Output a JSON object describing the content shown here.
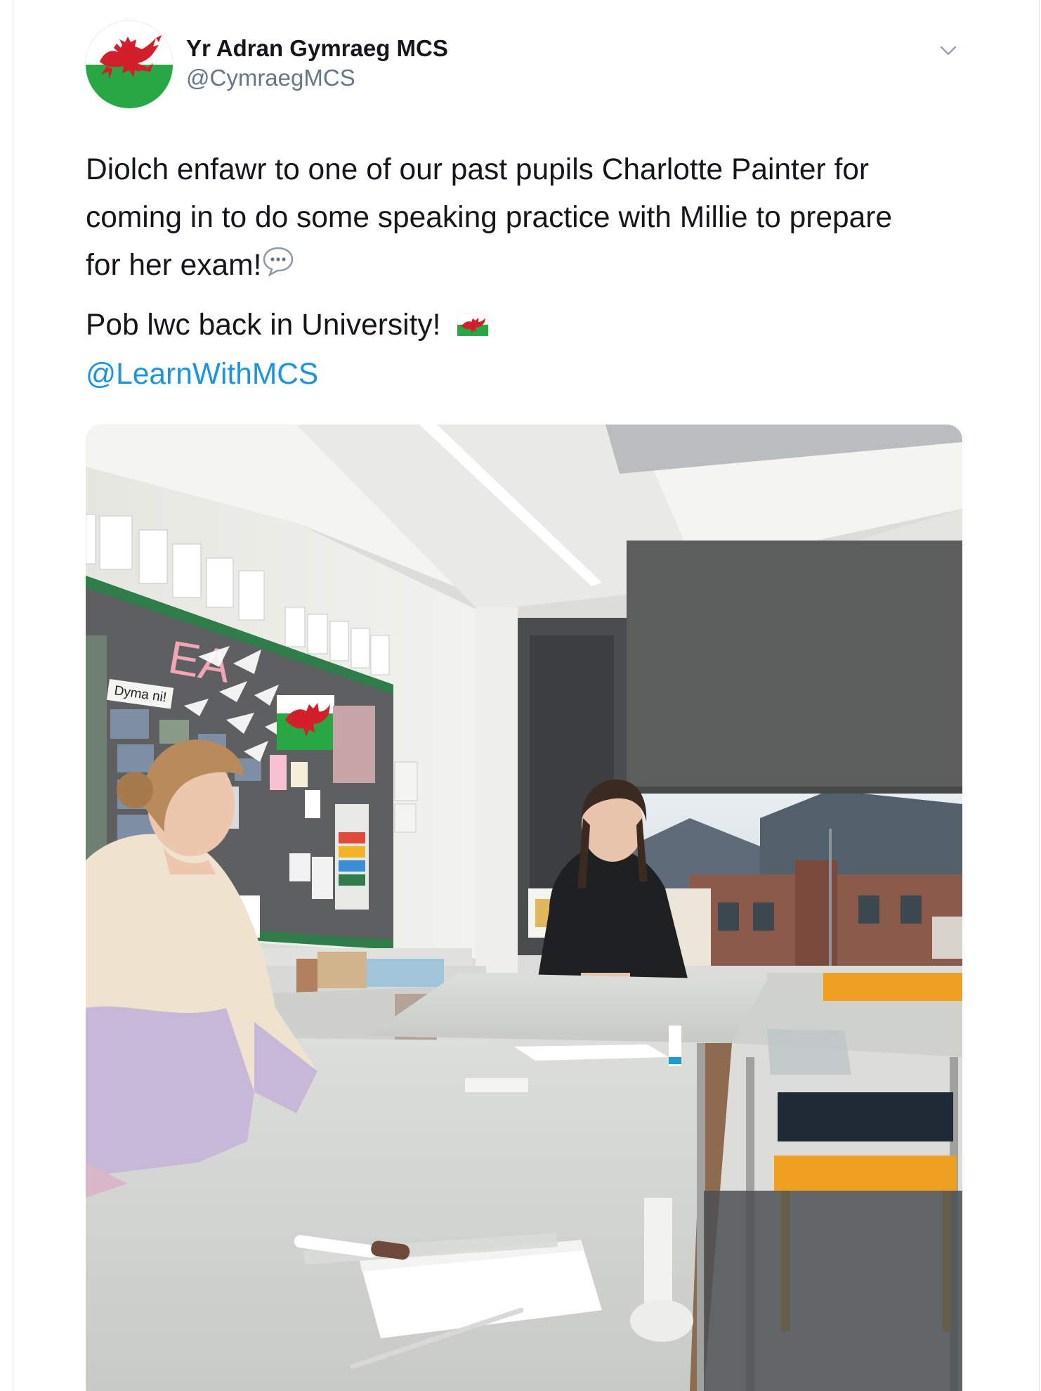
{
  "account": {
    "display_name": "Yr Adran Gymraeg MCS",
    "handle": "@CymraegMCS",
    "avatar_icon": "welsh-flag-icon"
  },
  "menu": {
    "icon": "chevron-down-icon"
  },
  "tweet": {
    "line1": "Diolch enfawr to one of our past pupils Charlotte Painter for",
    "line2": "coming in to do some speaking practice with Millie to prepare",
    "line3": "for her exam!",
    "line3_emoji": "speech-balloon-icon",
    "line4": "Pob lwc back in University!",
    "line4_emoji": "welsh-flag-icon",
    "mention": "@LearnWithMCS"
  },
  "photo": {
    "board_banner_text": "EA",
    "board_label": "Dyma ni!",
    "colors": {
      "wall": "#ebebe6",
      "board": "#5d5f61",
      "board_trim": "#2e7d4a",
      "blind": "#5c5e5d",
      "desk": "#d4d6d1",
      "flag_green": "#27a844",
      "flag_red": "#d21f2b"
    }
  },
  "colors": {
    "link": "#1b95e0",
    "text": "#14171a",
    "secondary": "#657786"
  }
}
